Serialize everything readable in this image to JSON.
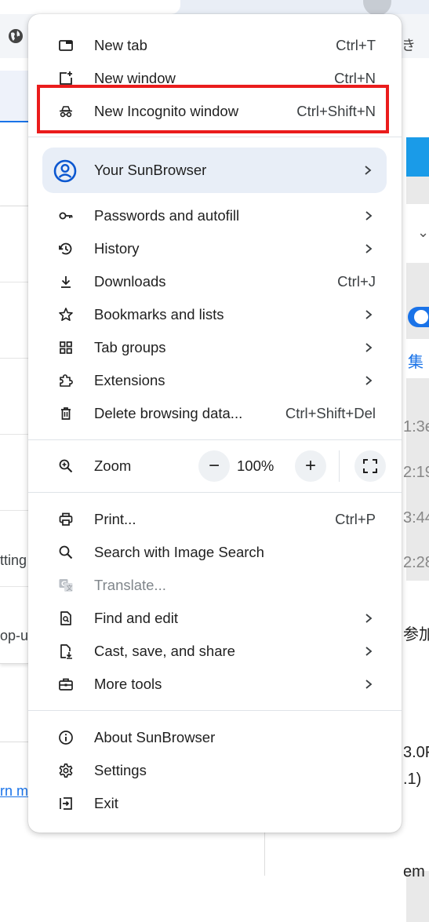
{
  "background": {
    "cjk_top": "き",
    "left_texts": [
      "tting",
      "op-u"
    ],
    "left_link": "rn m",
    "right_cjk_blue": "集",
    "right_times": [
      "1:3e",
      "2:19",
      "3:44",
      "2:28"
    ],
    "right_cjk_text": "参加",
    "right_text_a": "3.0F",
    "right_text_b": ".1)",
    "right_text_c": "em"
  },
  "menu": {
    "items_top": [
      {
        "id": "new-tab",
        "label": "New tab",
        "shortcut": "Ctrl+T",
        "icon": "new-tab-icon"
      },
      {
        "id": "new-window",
        "label": "New window",
        "shortcut": "Ctrl+N",
        "icon": "new-window-icon"
      },
      {
        "id": "new-incognito",
        "label": "New Incognito window",
        "shortcut": "Ctrl+Shift+N",
        "icon": "incognito-icon"
      }
    ],
    "profile": {
      "label": "Your SunBrowser",
      "icon": "account-circle-icon"
    },
    "items_mid": [
      {
        "id": "passwords",
        "label": "Passwords and autofill",
        "icon": "key-icon",
        "arrow": true
      },
      {
        "id": "history",
        "label": "History",
        "icon": "history-icon",
        "arrow": true
      },
      {
        "id": "downloads",
        "label": "Downloads",
        "shortcut": "Ctrl+J",
        "icon": "download-icon"
      },
      {
        "id": "bookmarks",
        "label": "Bookmarks and lists",
        "icon": "star-icon",
        "arrow": true
      },
      {
        "id": "tab-groups",
        "label": "Tab groups",
        "icon": "grid-icon",
        "arrow": true
      },
      {
        "id": "extensions",
        "label": "Extensions",
        "icon": "puzzle-icon",
        "arrow": true
      },
      {
        "id": "delete-data",
        "label": "Delete browsing data...",
        "shortcut": "Ctrl+Shift+Del",
        "icon": "trash-icon"
      }
    ],
    "zoom": {
      "label": "Zoom",
      "value": "100%",
      "minus": "−",
      "plus": "+"
    },
    "items_tools": [
      {
        "id": "print",
        "label": "Print...",
        "shortcut": "Ctrl+P",
        "icon": "printer-icon"
      },
      {
        "id": "image-search",
        "label": "Search with Image Search",
        "icon": "search-icon"
      },
      {
        "id": "translate",
        "label": "Translate...",
        "icon": "translate-icon",
        "disabled": true
      },
      {
        "id": "find-edit",
        "label": "Find and edit",
        "icon": "find-page-icon",
        "arrow": true
      },
      {
        "id": "cast-save",
        "label": "Cast, save, and share",
        "icon": "save-page-icon",
        "arrow": true
      },
      {
        "id": "more-tools",
        "label": "More tools",
        "icon": "toolbox-icon",
        "arrow": true
      }
    ],
    "items_bottom": [
      {
        "id": "about",
        "label": "About SunBrowser",
        "icon": "info-icon"
      },
      {
        "id": "settings",
        "label": "Settings",
        "icon": "gear-icon"
      },
      {
        "id": "exit",
        "label": "Exit",
        "icon": "exit-icon"
      }
    ]
  }
}
